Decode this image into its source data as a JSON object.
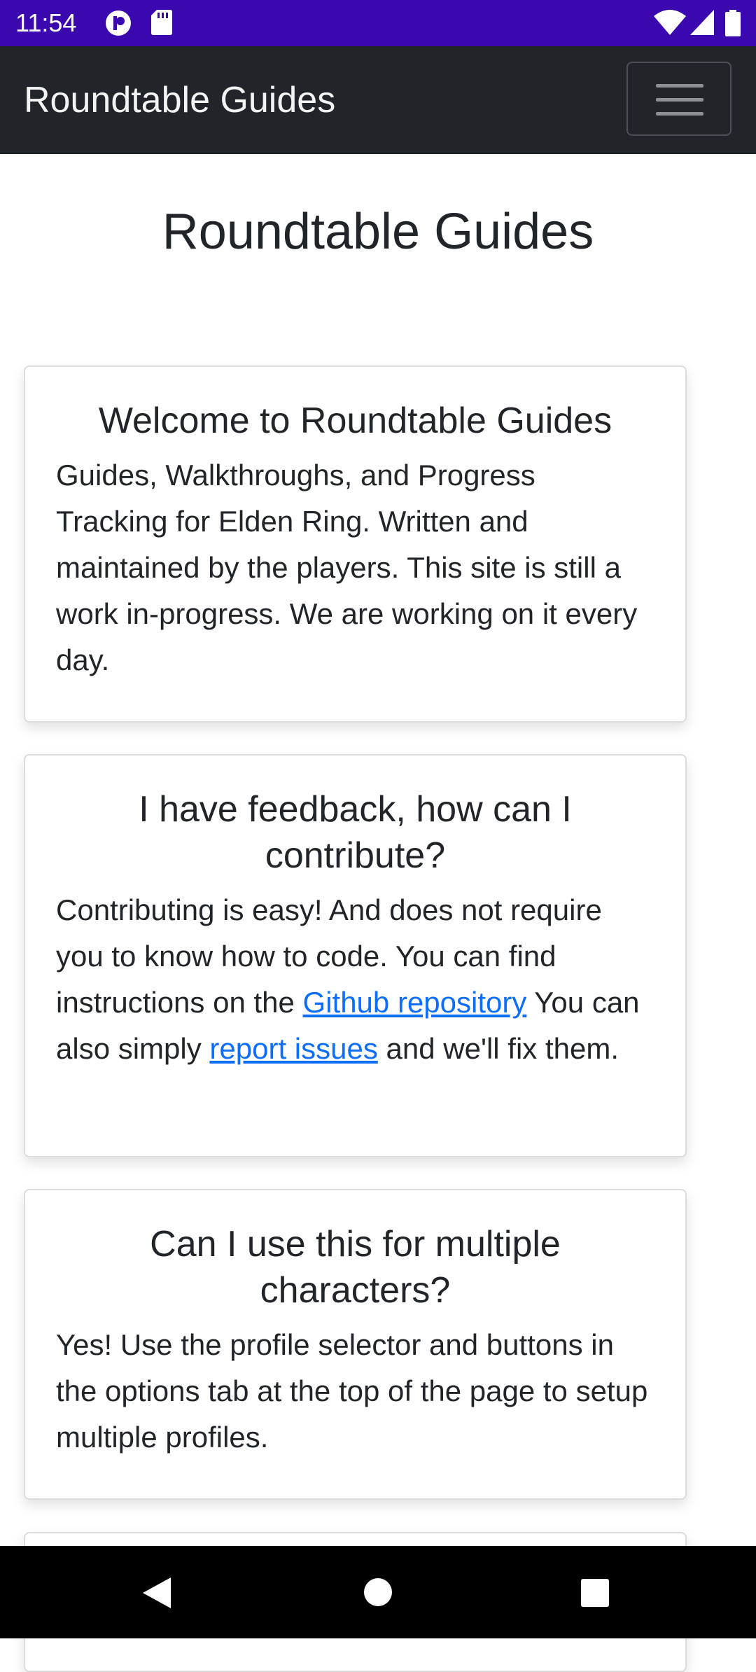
{
  "status_bar": {
    "time": "11:54",
    "left_icons": [
      "privacy-indicator-icon",
      "sd-card-icon"
    ],
    "right_icons": [
      "wifi-icon",
      "cellular-signal-icon",
      "battery-icon"
    ],
    "background_color": "#3b08b0"
  },
  "navbar": {
    "brand": "Roundtable Guides",
    "toggler_icon": "hamburger-menu-icon",
    "background_color": "#212529"
  },
  "page": {
    "title": "Roundtable Guides"
  },
  "cards": [
    {
      "title": "Welcome to Roundtable Guides",
      "text": "Guides, Walkthroughs, and Progress Tracking for Elden Ring. Written and maintained by the players. This site is still a work in-progress. We are working on it every day."
    },
    {
      "title": "I have feedback, how can I contribute?",
      "text_before_link1": "Contributing is easy! And does not require you to know how to code. You can find instructions on the ",
      "link1": "Github repository",
      "text_between_links": " You can also simply ",
      "link2": "report issues",
      "text_after_link2": " and we'll fix them."
    },
    {
      "title": "Can I use this for multiple characters?",
      "text": "Yes! Use the profile selector and buttons in the options tab at the top of the page to setup multiple profiles."
    }
  ],
  "system_nav": {
    "buttons": [
      "back-icon",
      "home-icon",
      "recents-icon"
    ]
  },
  "colors": {
    "link": "#0d6efd",
    "text": "#212529"
  }
}
